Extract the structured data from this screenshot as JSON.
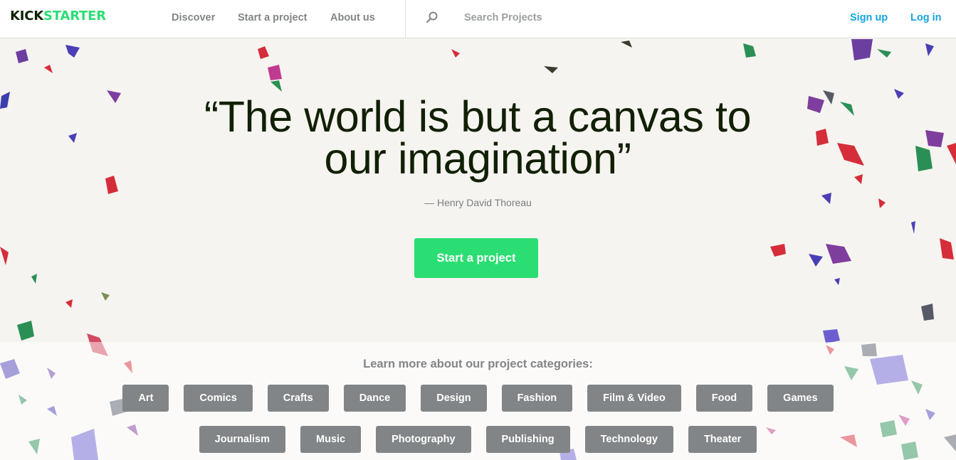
{
  "brand": {
    "part1": "KICK",
    "part2": "STARTER",
    "accent_color": "#2bde73",
    "dark_color": "#0f2105"
  },
  "nav": [
    {
      "id": "discover",
      "label": "Discover"
    },
    {
      "id": "start-a-project",
      "label": "Start a project"
    },
    {
      "id": "about-us",
      "label": "About us"
    }
  ],
  "search": {
    "placeholder": "Search Projects",
    "value": "",
    "icon": "search-icon"
  },
  "auth": {
    "sign_up": "Sign up",
    "log_in": "Log in",
    "link_color": "#14a4e1"
  },
  "hero": {
    "quote_line1": "“The world is but a canvas to",
    "quote_line2": "our imagination”",
    "attribution": "— Henry David Thoreau",
    "cta_label": "Start a project"
  },
  "categories": {
    "heading": "Learn more about our project categories:",
    "row1": [
      "Art",
      "Comics",
      "Crafts",
      "Dance",
      "Design",
      "Fashion",
      "Film & Video",
      "Food",
      "Games"
    ],
    "row2": [
      "Journalism",
      "Music",
      "Photography",
      "Publishing",
      "Technology",
      "Theater"
    ],
    "button_color": "#828587"
  }
}
